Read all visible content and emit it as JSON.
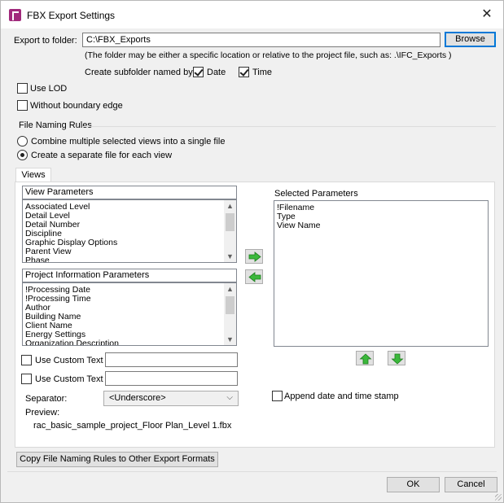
{
  "window": {
    "title": "FBX Export Settings",
    "close_glyph": "✕"
  },
  "export": {
    "folder_label": "Export to folder:",
    "folder_value": "C:\\FBX_Exports",
    "browse_label": "Browse",
    "hint": "(The folder may be either a specific location or relative to the project file, such as:  .\\IFC_Exports )",
    "subfolder_label": "Create subfolder named by:",
    "date_label": "Date",
    "date_checked": true,
    "time_label": "Time",
    "time_checked": true
  },
  "options": {
    "use_lod_label": "Use LOD",
    "use_lod_checked": false,
    "without_boundary_label": "Without boundary edge",
    "without_boundary_checked": false
  },
  "naming": {
    "group_label": "File Naming Rules",
    "combine_label": "Combine multiple selected views into a single file",
    "combine_selected": false,
    "separate_label": "Create a separate file for each view",
    "separate_selected": true
  },
  "tabs": [
    {
      "label": "Views",
      "active": true
    }
  ],
  "view_parameters": {
    "header": "View Parameters",
    "items": [
      "Associated Level",
      "Detail Level",
      "Detail Number",
      "Discipline",
      "Graphic Display Options",
      "Parent View",
      "Phase"
    ]
  },
  "project_parameters": {
    "header": "Project Information Parameters",
    "items": [
      "!Processing Date",
      "!Processing Time",
      "Author",
      "Building Name",
      "Client Name",
      "Energy Settings",
      "Organization Description"
    ]
  },
  "selected_parameters": {
    "header": "Selected Parameters",
    "items": [
      "!Filename",
      "Type",
      "View Name"
    ]
  },
  "custom": {
    "text1_label": "Use Custom Text 1",
    "text1_checked": false,
    "text1_value": "",
    "text2_label": "Use Custom Text 2",
    "text2_checked": false,
    "text2_value": ""
  },
  "separator": {
    "label": "Separator:",
    "value": "<Underscore>"
  },
  "append": {
    "label": "Append date and time stamp",
    "checked": false
  },
  "preview": {
    "label": "Preview:",
    "value": "rac_basic_sample_project_Floor Plan_Level 1.fbx"
  },
  "footer": {
    "copy_rules_label": "Copy File Naming Rules to Other Export Formats",
    "ok_label": "OK",
    "cancel_label": "Cancel"
  },
  "colors": {
    "arrow_green": "#3bb83b",
    "app_icon": "#a12a7c",
    "accent": "#0078d7"
  },
  "icons": {
    "add": "arrow-right-icon",
    "remove": "arrow-left-icon",
    "move_up": "arrow-up-icon",
    "move_down": "arrow-down-icon"
  }
}
